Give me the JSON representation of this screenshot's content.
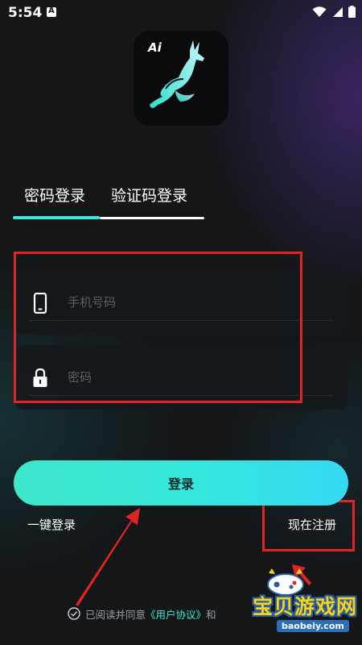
{
  "status_bar": {
    "time": "5:54"
  },
  "app": {
    "logo_text": "Ai"
  },
  "tabs": [
    {
      "label": "密码登录",
      "active": true
    },
    {
      "label": "验证码登录",
      "active": false
    }
  ],
  "form": {
    "phone_placeholder": "手机号码",
    "phone_value": "",
    "password_placeholder": "密码",
    "password_value": ""
  },
  "actions": {
    "login_label": "登录",
    "quick_login_label": "一键登录",
    "register_label": "现在注册"
  },
  "agreement": {
    "prefix": "已阅读并同意",
    "user_agreement": "《用户协议》",
    "conjunction": "和"
  },
  "watermark": {
    "title": "宝贝游戏网",
    "url": "baobeiy.com"
  },
  "colors": {
    "accent": "#3ee8d6",
    "annotation": "#e02424",
    "background": "#141618"
  }
}
